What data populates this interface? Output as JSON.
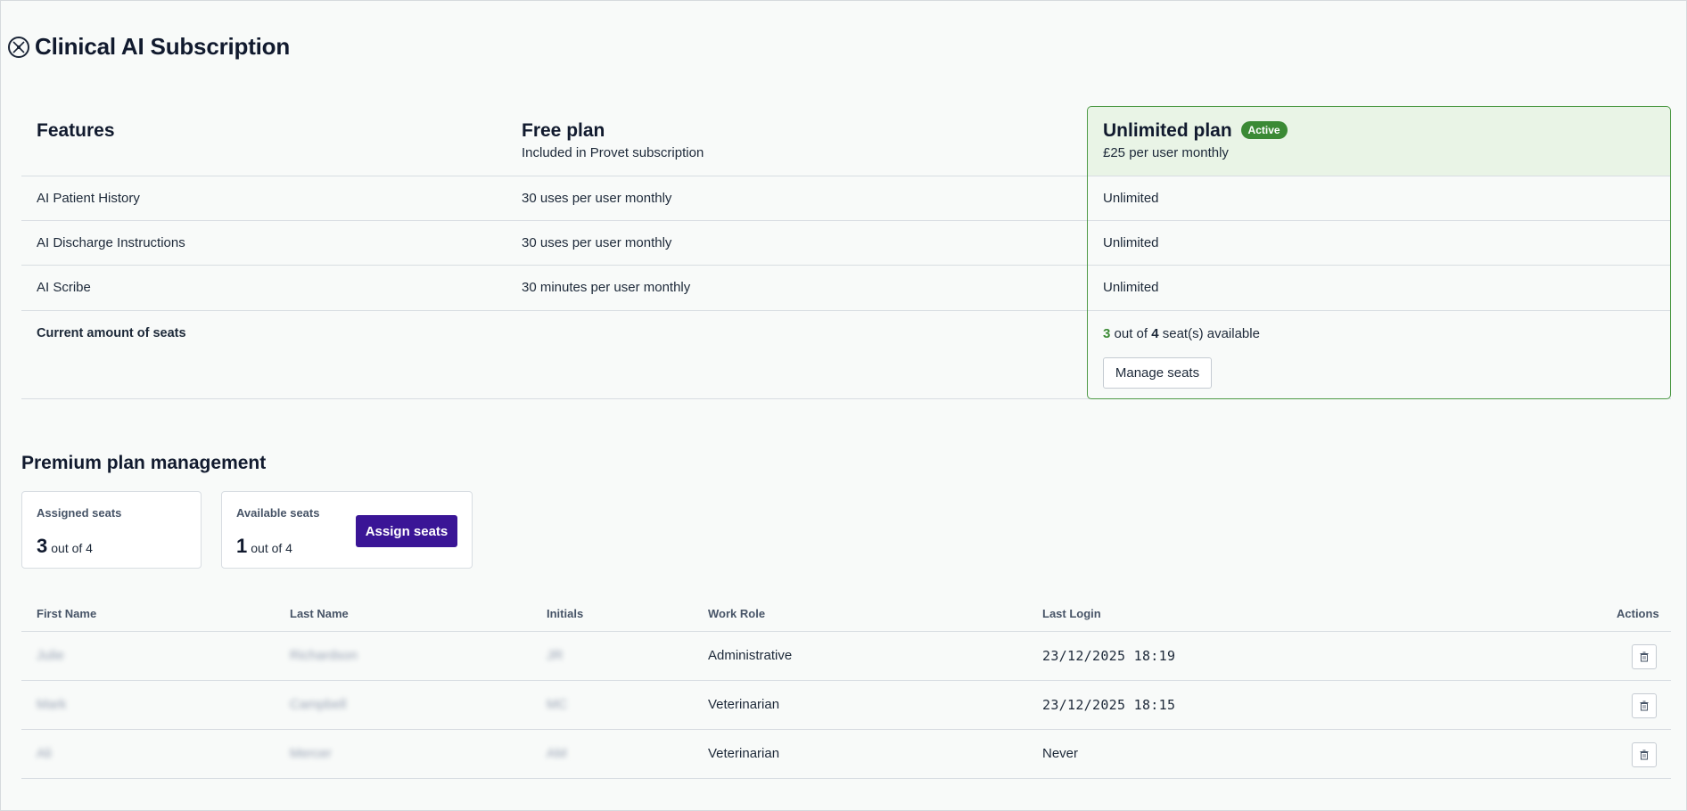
{
  "header": {
    "title": "Clinical AI Subscription",
    "logo_icon": "clinical-ai-logo-icon"
  },
  "plans": {
    "columns": {
      "features": {
        "title": "Features"
      },
      "free": {
        "title": "Free plan",
        "subtitle": "Included in Provet subscription"
      },
      "unlimited": {
        "title": "Unlimited plan",
        "badge": "Active",
        "subtitle": "£25 per user monthly"
      }
    },
    "rows": [
      {
        "feature": "AI Patient History",
        "free": "30 uses per user monthly",
        "unlimited": "Unlimited"
      },
      {
        "feature": "AI Discharge Instructions",
        "free": "30 uses per user monthly",
        "unlimited": "Unlimited"
      },
      {
        "feature": "AI Scribe",
        "free": "30 minutes per user monthly",
        "unlimited": "Unlimited"
      }
    ],
    "seats_row": {
      "label": "Current amount of seats",
      "available": "3",
      "out_of_text": "out of",
      "total": "4",
      "suffix": "seat(s) available",
      "manage_button": "Manage seats"
    },
    "accent_color": "#3b8a35"
  },
  "premium": {
    "title": "Premium plan management",
    "assigned": {
      "label": "Assigned seats",
      "count": "3",
      "out_of": "out of 4"
    },
    "available": {
      "label": "Available seats",
      "count": "1",
      "out_of": "out of 4"
    },
    "assign_button": "Assign seats",
    "primary_color": "#3a1596"
  },
  "users": {
    "columns": [
      "First Name",
      "Last Name",
      "Initials",
      "Work Role",
      "Last Login",
      "Actions"
    ],
    "rows": [
      {
        "first_name": "Julie",
        "last_name": "Richardson",
        "initials": "JR",
        "work_role": "Administrative",
        "last_login": "23/12/2025 18:19",
        "action_icon": "trash-icon"
      },
      {
        "first_name": "Mark",
        "last_name": "Campbell",
        "initials": "MC",
        "work_role": "Veterinarian",
        "last_login": "23/12/2025 18:15",
        "action_icon": "trash-icon"
      },
      {
        "first_name": "Ali",
        "last_name": "Mercer",
        "initials": "AM",
        "work_role": "Veterinarian",
        "last_login": "Never",
        "action_icon": "trash-icon"
      }
    ]
  }
}
